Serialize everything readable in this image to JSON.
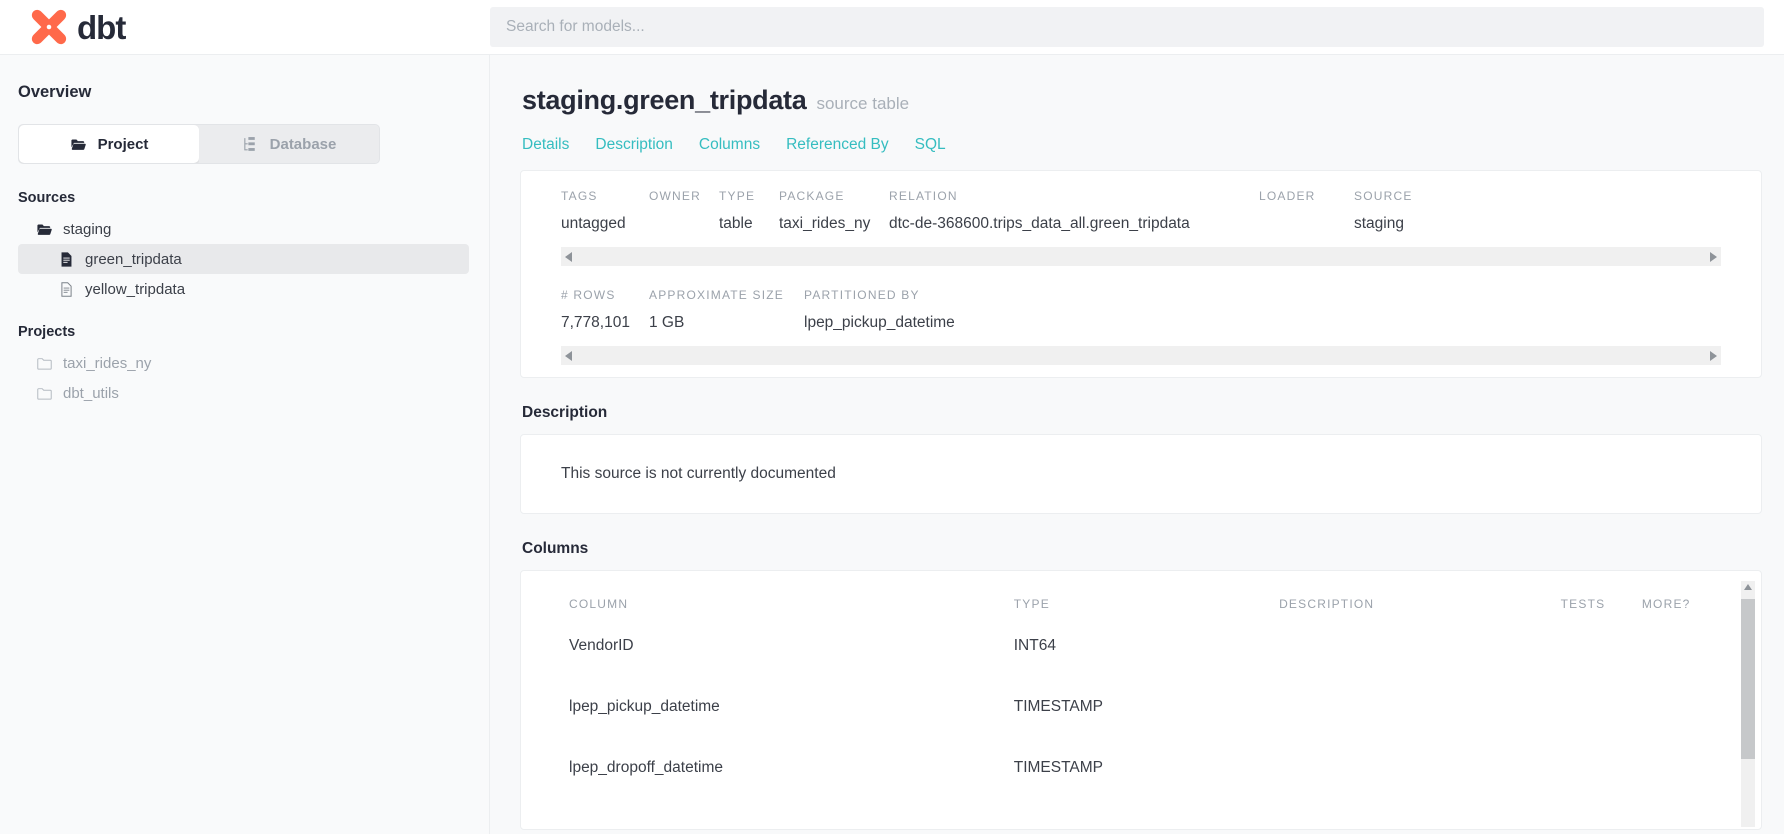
{
  "brand": {
    "name": "dbt",
    "logo_icon": "dbt-x-logo",
    "logo_color": "#FF694A"
  },
  "search": {
    "placeholder": "Search for models...",
    "value": ""
  },
  "sidebar": {
    "overview_label": "Overview",
    "toggle": {
      "project_label": "Project",
      "database_label": "Database",
      "active": "Project"
    },
    "sources": {
      "heading": "Sources",
      "folder": {
        "label": "staging",
        "icon": "open-folder-icon"
      },
      "items": [
        {
          "label": "green_tripdata",
          "icon": "file-filled-icon",
          "selected": true
        },
        {
          "label": "yellow_tripdata",
          "icon": "file-outline-icon",
          "selected": false
        }
      ]
    },
    "projects": {
      "heading": "Projects",
      "items": [
        {
          "label": "taxi_rides_ny",
          "icon": "closed-folder-icon"
        },
        {
          "label": "dbt_utils",
          "icon": "closed-folder-icon"
        }
      ]
    }
  },
  "main": {
    "title": "staging.green_tripdata",
    "subtitle": "source table",
    "tabs": [
      {
        "label": "Details"
      },
      {
        "label": "Description"
      },
      {
        "label": "Columns"
      },
      {
        "label": "Referenced By"
      },
      {
        "label": "SQL"
      }
    ],
    "details_row1": [
      {
        "label": "TAGS",
        "value": "untagged"
      },
      {
        "label": "OWNER",
        "value": ""
      },
      {
        "label": "TYPE",
        "value": "table"
      },
      {
        "label": "PACKAGE",
        "value": "taxi_rides_ny"
      },
      {
        "label": "RELATION",
        "value": "dtc-de-368600.trips_data_all.green_tripdata"
      },
      {
        "label": "LOADER",
        "value": ""
      },
      {
        "label": "SOURCE",
        "value": "staging"
      }
    ],
    "details_row2": [
      {
        "label": "# ROWS",
        "value": "7,778,101"
      },
      {
        "label": "APPROXIMATE SIZE",
        "value": "1 GB"
      },
      {
        "label": "PARTITIONED BY",
        "value": "lpep_pickup_datetime"
      }
    ],
    "description": {
      "heading": "Description",
      "body": "This source is not currently documented"
    },
    "columns": {
      "heading": "Columns",
      "table_headers": [
        "COLUMN",
        "TYPE",
        "DESCRIPTION",
        "TESTS",
        "MORE?"
      ],
      "rows": [
        {
          "column": "VendorID",
          "type": "INT64",
          "description": "",
          "tests": "",
          "more": ""
        },
        {
          "column": "lpep_pickup_datetime",
          "type": "TIMESTAMP",
          "description": "",
          "tests": "",
          "more": ""
        },
        {
          "column": "lpep_dropoff_datetime",
          "type": "TIMESTAMP",
          "description": "",
          "tests": "",
          "more": ""
        }
      ]
    }
  }
}
